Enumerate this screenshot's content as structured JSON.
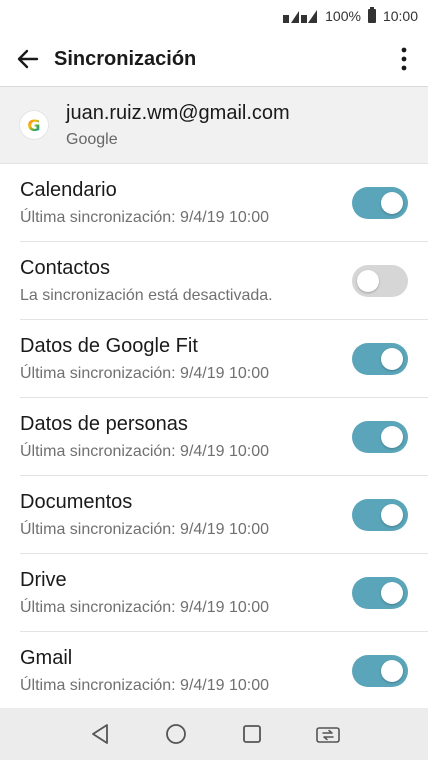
{
  "status_bar": {
    "battery_text": "100%",
    "time": "10:00"
  },
  "app_bar": {
    "title": "Sincronización",
    "back_icon": "arrow-left-icon",
    "more_icon": "more-vertical-icon"
  },
  "account": {
    "email": "juan.ruiz.wm@gmail.com",
    "type": "Google",
    "logo_letter": "G"
  },
  "sync_items": [
    {
      "title": "Calendario",
      "subtitle": "Última sincronización: 9/4/19 10:00",
      "enabled": true
    },
    {
      "title": "Contactos",
      "subtitle": "La sincronización está desactivada.",
      "enabled": false
    },
    {
      "title": "Datos de Google Fit",
      "subtitle": "Última sincronización: 9/4/19 10:00",
      "enabled": true
    },
    {
      "title": "Datos de personas",
      "subtitle": "Última sincronización: 9/4/19 10:00",
      "enabled": true
    },
    {
      "title": "Documentos",
      "subtitle": "Última sincronización: 9/4/19 10:00",
      "enabled": true
    },
    {
      "title": "Drive",
      "subtitle": "Última sincronización: 9/4/19 10:00",
      "enabled": true
    },
    {
      "title": "Gmail",
      "subtitle": "Última sincronización: 9/4/19 10:00",
      "enabled": true
    }
  ],
  "colors": {
    "toggle_on": "#5aa5b9",
    "toggle_off": "#d6d6d6",
    "account_bg": "#f1f1f1",
    "nav_bg": "#ececec"
  },
  "nav_bar": {
    "icons": [
      "back-triangle-icon",
      "home-circle-icon",
      "recents-square-icon",
      "switch-sim-icon"
    ]
  }
}
